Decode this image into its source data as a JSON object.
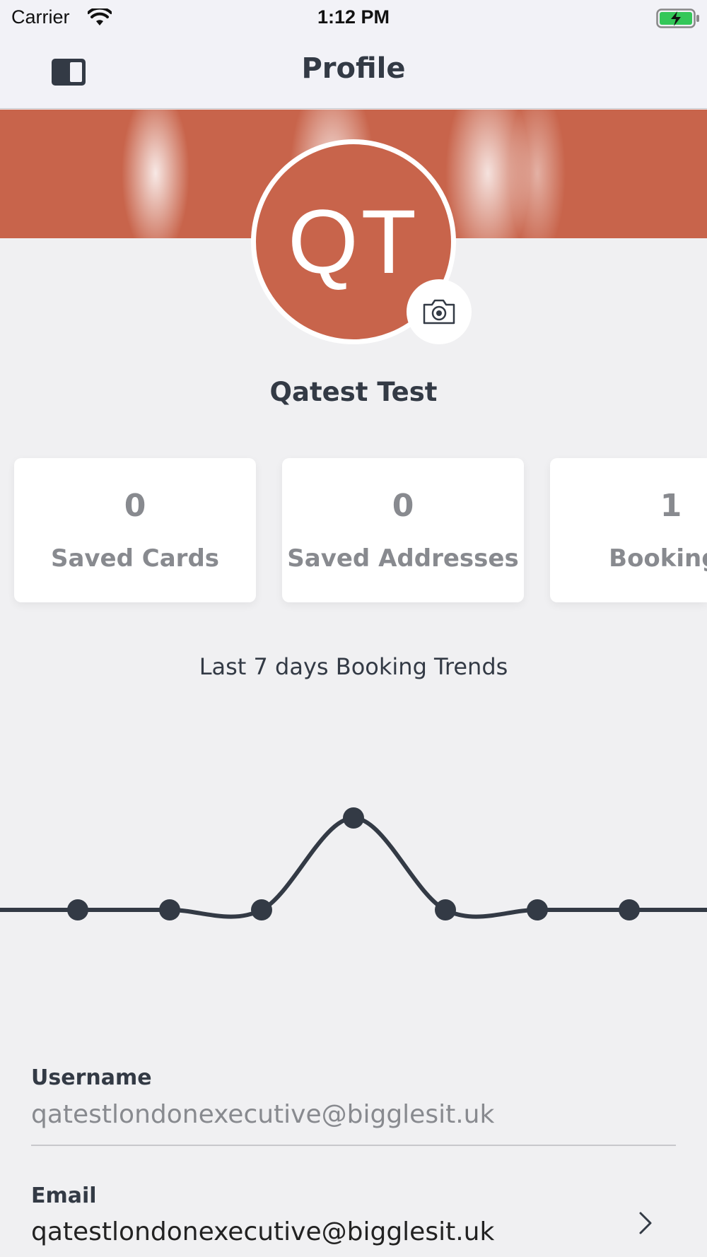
{
  "status_bar": {
    "carrier": "Carrier",
    "time": "1:12 PM",
    "battery_color": "#34c759"
  },
  "nav": {
    "title": "Profile",
    "left_icon": "sidebar-toggle-icon"
  },
  "profile": {
    "initials": "QT",
    "name": "Qatest Test",
    "accent_color": "#c8644b",
    "camera_icon": "camera-icon"
  },
  "stats": [
    {
      "value": "0",
      "label": "Saved Cards"
    },
    {
      "value": "0",
      "label": "Saved Addresses"
    },
    {
      "value": "1",
      "label": "Bookings"
    }
  ],
  "trends": {
    "title": "Last 7 days Booking Trends"
  },
  "chart_data": {
    "type": "line",
    "title": "Last 7 days Booking Trends",
    "x": [
      1,
      2,
      3,
      4,
      5,
      6,
      7
    ],
    "series": [
      {
        "values": [
          0,
          0,
          0,
          1,
          0,
          0,
          0
        ]
      }
    ],
    "ylim": [
      0,
      1
    ],
    "grid": false,
    "smooth": true,
    "color": "#333a45"
  },
  "fields": {
    "username_label": "Username",
    "username_value": "qatestlondonexecutive@bigglesit.uk",
    "email_label": "Email",
    "email_value": "qatestlondonexecutive@bigglesit.uk"
  }
}
